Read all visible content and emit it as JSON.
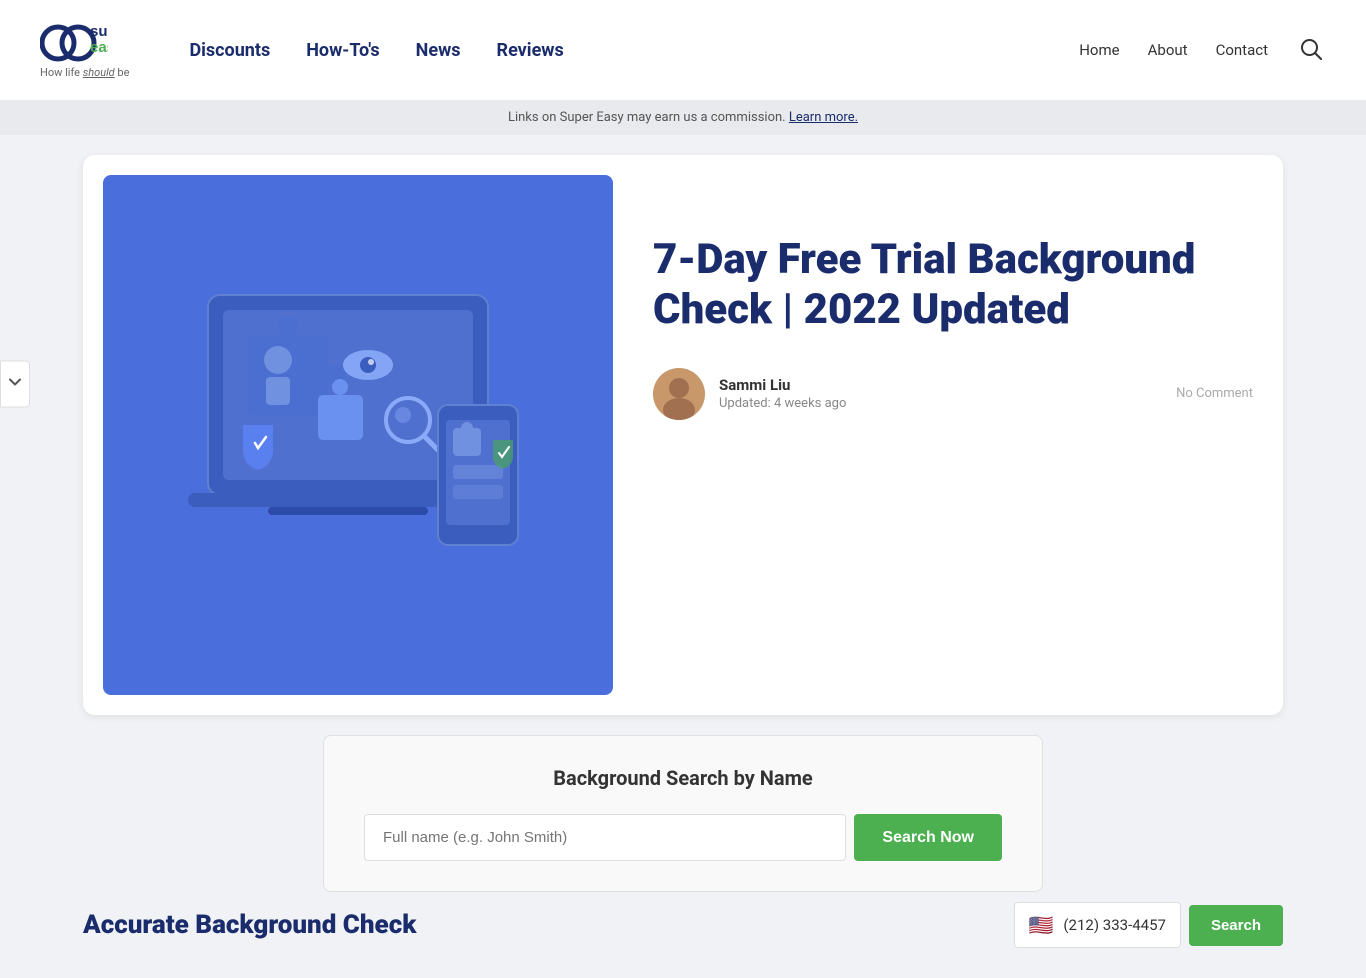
{
  "header": {
    "logo_tagline": "How life ",
    "logo_tagline_bold": "should",
    "logo_tagline_end": " be",
    "nav": {
      "items": [
        {
          "label": "Discounts",
          "href": "#"
        },
        {
          "label": "How-To's",
          "href": "#"
        },
        {
          "label": "News",
          "href": "#"
        },
        {
          "label": "Reviews",
          "href": "#"
        }
      ]
    },
    "right_nav": [
      {
        "label": "Home",
        "href": "#"
      },
      {
        "label": "About",
        "href": "#"
      },
      {
        "label": "Contact",
        "href": "#"
      }
    ]
  },
  "commission_bar": {
    "text": "Links on Super Easy may earn us a commission. ",
    "link_text": "Learn more."
  },
  "article": {
    "title": "7-Day Free Trial Background Check | 2022 Updated",
    "author": {
      "name": "Sammi Liu",
      "updated": "Updated: 4 weeks ago"
    },
    "no_comment": "No Comment"
  },
  "search_widget": {
    "title": "Background Search by Name",
    "input_placeholder": "Full name (e.g. John Smith)",
    "button_label": "Search Now"
  },
  "bottom": {
    "title": "Accurate Background Check",
    "phone_value": "(212) 333-4457",
    "search_button": "Search"
  }
}
